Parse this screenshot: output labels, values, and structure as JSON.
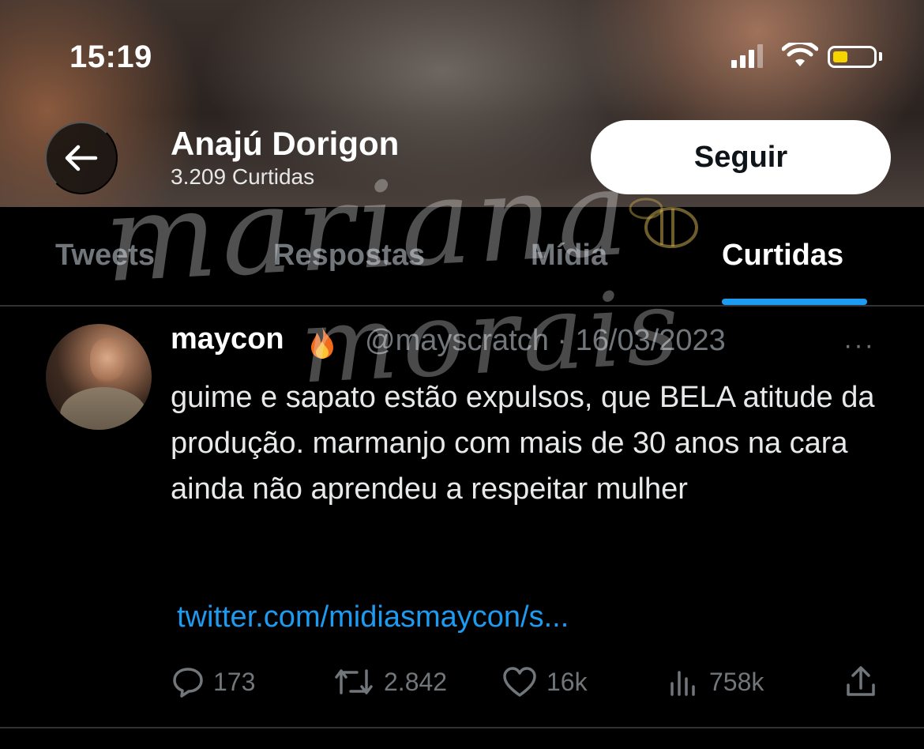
{
  "status_bar": {
    "time": "15:19",
    "battery_color": "#f5d400",
    "battery_level": 0.35
  },
  "profile_header": {
    "back_icon": "arrow-left-icon",
    "name": "Anajú Dorigon",
    "likes_count": "3.209 Curtidas",
    "follow_label": "Seguir"
  },
  "tabs": [
    {
      "label": "Tweets",
      "active": false
    },
    {
      "label": "Respostas",
      "active": false
    },
    {
      "label": "Mídia",
      "active": false
    },
    {
      "label": "Curtidas",
      "active": true
    }
  ],
  "tweet": {
    "name": "maycon",
    "emoji": "fire-icon",
    "handle_date": "@mayscratch · 16/03/2023",
    "more": "···",
    "text": "guime e sapato estão expulsos, que BELA atitude da produção. marmanjo com mais de 30 anos na cara ainda não aprendeu a respeitar mulher",
    "link": "twitter.com/midiasmaycon/s...",
    "replies": "173",
    "retweets": "2.842",
    "likes": "16k",
    "views": "758k"
  },
  "watermark": {
    "line1": "mariana",
    "line2": "morais"
  },
  "colors": {
    "accent": "#1d9bf0",
    "muted": "#71767b",
    "background": "#000000"
  }
}
